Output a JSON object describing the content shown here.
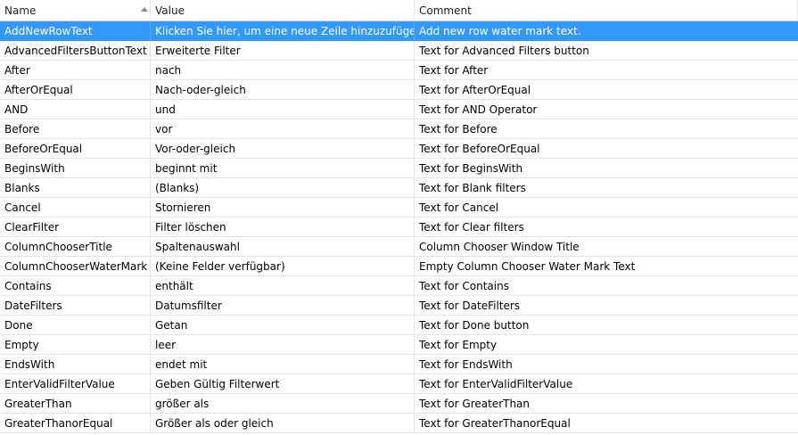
{
  "columns": {
    "name": "Name",
    "value": "Value",
    "comment": "Comment"
  },
  "colors": {
    "selected_row": "#3399ff",
    "grid_line": "#e3e3e3"
  },
  "selected_row": "AddNewRowText",
  "rows": [
    {
      "name": "AddNewRowText",
      "value": "Klicken Sie hier, um eine neue Zeile hinzuzufügen",
      "comment": "Add new row water mark text."
    },
    {
      "name": "AdvancedFiltersButtonText",
      "value": "Erweiterte Filter",
      "comment": "Text for Advanced Filters button"
    },
    {
      "name": "After",
      "value": "nach",
      "comment": "Text for After"
    },
    {
      "name": "AfterOrEqual",
      "value": "Nach-oder-gleich",
      "comment": "Text for AfterOrEqual"
    },
    {
      "name": "AND",
      "value": "und",
      "comment": "Text for AND Operator"
    },
    {
      "name": "Before",
      "value": "vor",
      "comment": "Text for Before"
    },
    {
      "name": "BeforeOrEqual",
      "value": "Vor-oder-gleich",
      "comment": "Text for BeforeOrEqual"
    },
    {
      "name": "BeginsWith",
      "value": "beginnt mit",
      "comment": "Text for BeginsWith"
    },
    {
      "name": "Blanks",
      "value": "(Blanks)",
      "comment": "Text for Blank filters"
    },
    {
      "name": "Cancel",
      "value": "Stornieren",
      "comment": "Text for Cancel"
    },
    {
      "name": "ClearFilter",
      "value": "Filter löschen",
      "comment": "Text for Clear filters"
    },
    {
      "name": "ColumnChooserTitle",
      "value": "Spaltenauswahl",
      "comment": "Column Chooser Window Title"
    },
    {
      "name": "ColumnChooserWaterMark",
      "value": "(Keine Felder verfügbar)",
      "comment": "Empty Column Chooser Water Mark Text"
    },
    {
      "name": "Contains",
      "value": "enthält",
      "comment": "Text for Contains"
    },
    {
      "name": "DateFilters",
      "value": "Datumsfilter",
      "comment": "Text for DateFilters"
    },
    {
      "name": "Done",
      "value": "Getan",
      "comment": "Text for Done button"
    },
    {
      "name": "Empty",
      "value": "leer",
      "comment": "Text for Empty"
    },
    {
      "name": "EndsWith",
      "value": "endet mit",
      "comment": "Text for EndsWith"
    },
    {
      "name": "EnterValidFilterValue",
      "value": "Geben Gültig Filterwert",
      "comment": "Text for EnterValidFilterValue"
    },
    {
      "name": "GreaterThan",
      "value": "größer als",
      "comment": "Text for GreaterThan"
    },
    {
      "name": "GreaterThanorEqual",
      "value": "Größer als oder gleich",
      "comment": "Text for GreaterThanorEqual"
    }
  ]
}
